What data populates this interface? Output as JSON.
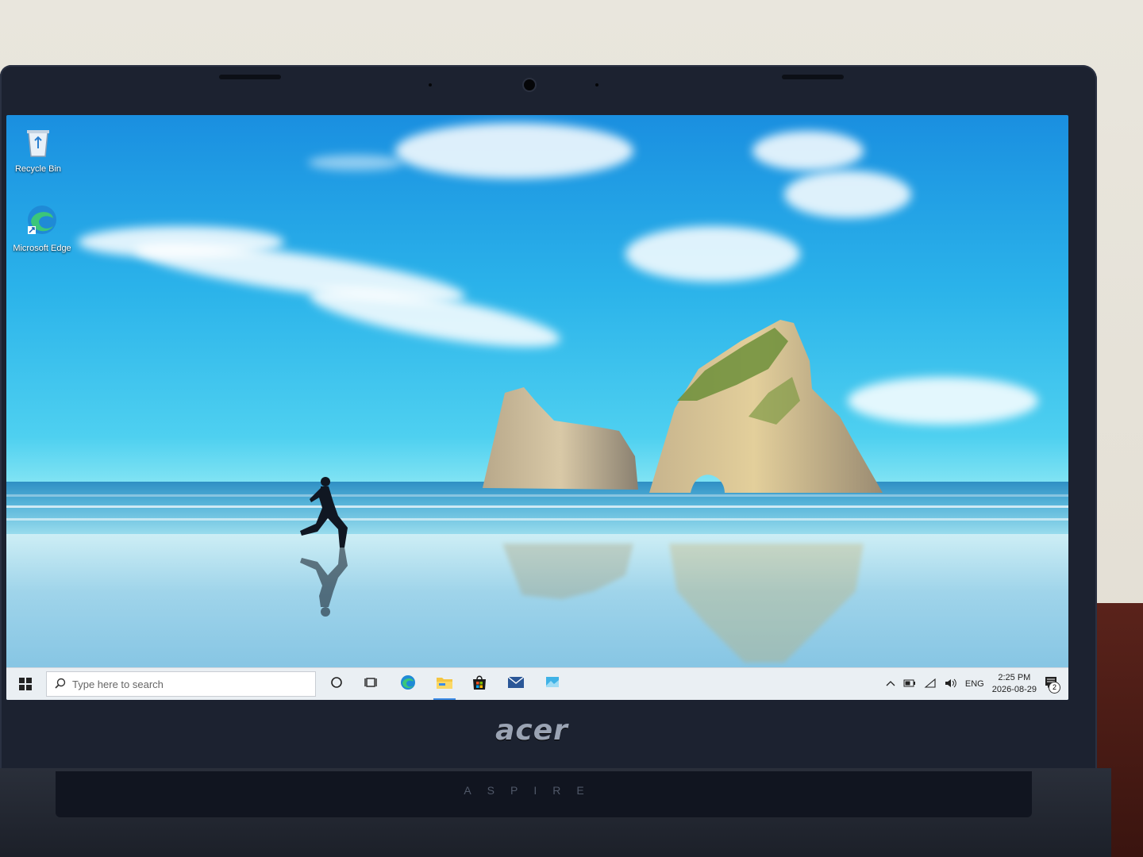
{
  "desktop": {
    "icons": [
      {
        "label": "Recycle Bin",
        "icon": "recycle-bin-icon"
      },
      {
        "label": "Microsoft Edge",
        "icon": "edge-icon"
      }
    ]
  },
  "taskbar": {
    "search_placeholder": "Type here to search",
    "pinned": [
      {
        "name": "cortana",
        "icon": "cortana-circle-icon"
      },
      {
        "name": "task-view",
        "icon": "task-view-icon"
      },
      {
        "name": "edge",
        "icon": "edge-icon"
      },
      {
        "name": "file-explorer",
        "icon": "folder-icon"
      },
      {
        "name": "store",
        "icon": "store-bag-icon"
      },
      {
        "name": "mail",
        "icon": "mail-icon"
      },
      {
        "name": "photos",
        "icon": "photos-icon"
      }
    ],
    "tray": {
      "language": "ENG",
      "time": "2:25 PM",
      "date": "2026-08-29",
      "notification_count": "2"
    }
  },
  "hardware": {
    "brand": "acer",
    "model": "ASPIRE"
  },
  "colors": {
    "accent": "#3c8ce7",
    "taskbar": "#eef0f4"
  }
}
